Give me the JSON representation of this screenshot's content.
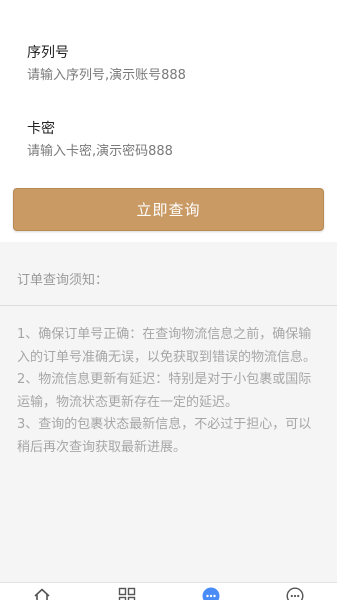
{
  "form": {
    "serial_label": "序列号",
    "serial_placeholder": "请输入序列号,演示账号888",
    "card_label": "卡密",
    "card_placeholder": "请输入卡密,演示密码888",
    "submit_label": "立即查询"
  },
  "notice": {
    "title": "订单查询须知：",
    "items": [
      "1、确保订单号正确：在查询物流信息之前，确保输入的订单号准确无误，以免获取到错误的物流信息。",
      "2、物流信息更新有延迟：特别是对于小包裹或国际运输，物流状态更新存在一定的延迟。",
      "3、查询的包裹状态最新信息，不必过于担心，可以稍后再次查询获取最新进展。"
    ]
  },
  "tabbar": {
    "icons": [
      "home-icon",
      "grid-icon",
      "chat-dots-icon",
      "more-icon"
    ],
    "active_index": 2
  },
  "colors": {
    "accent": "#c99a64",
    "active_tab": "#4a8cf7",
    "notice_background": "#f5f5f5"
  }
}
